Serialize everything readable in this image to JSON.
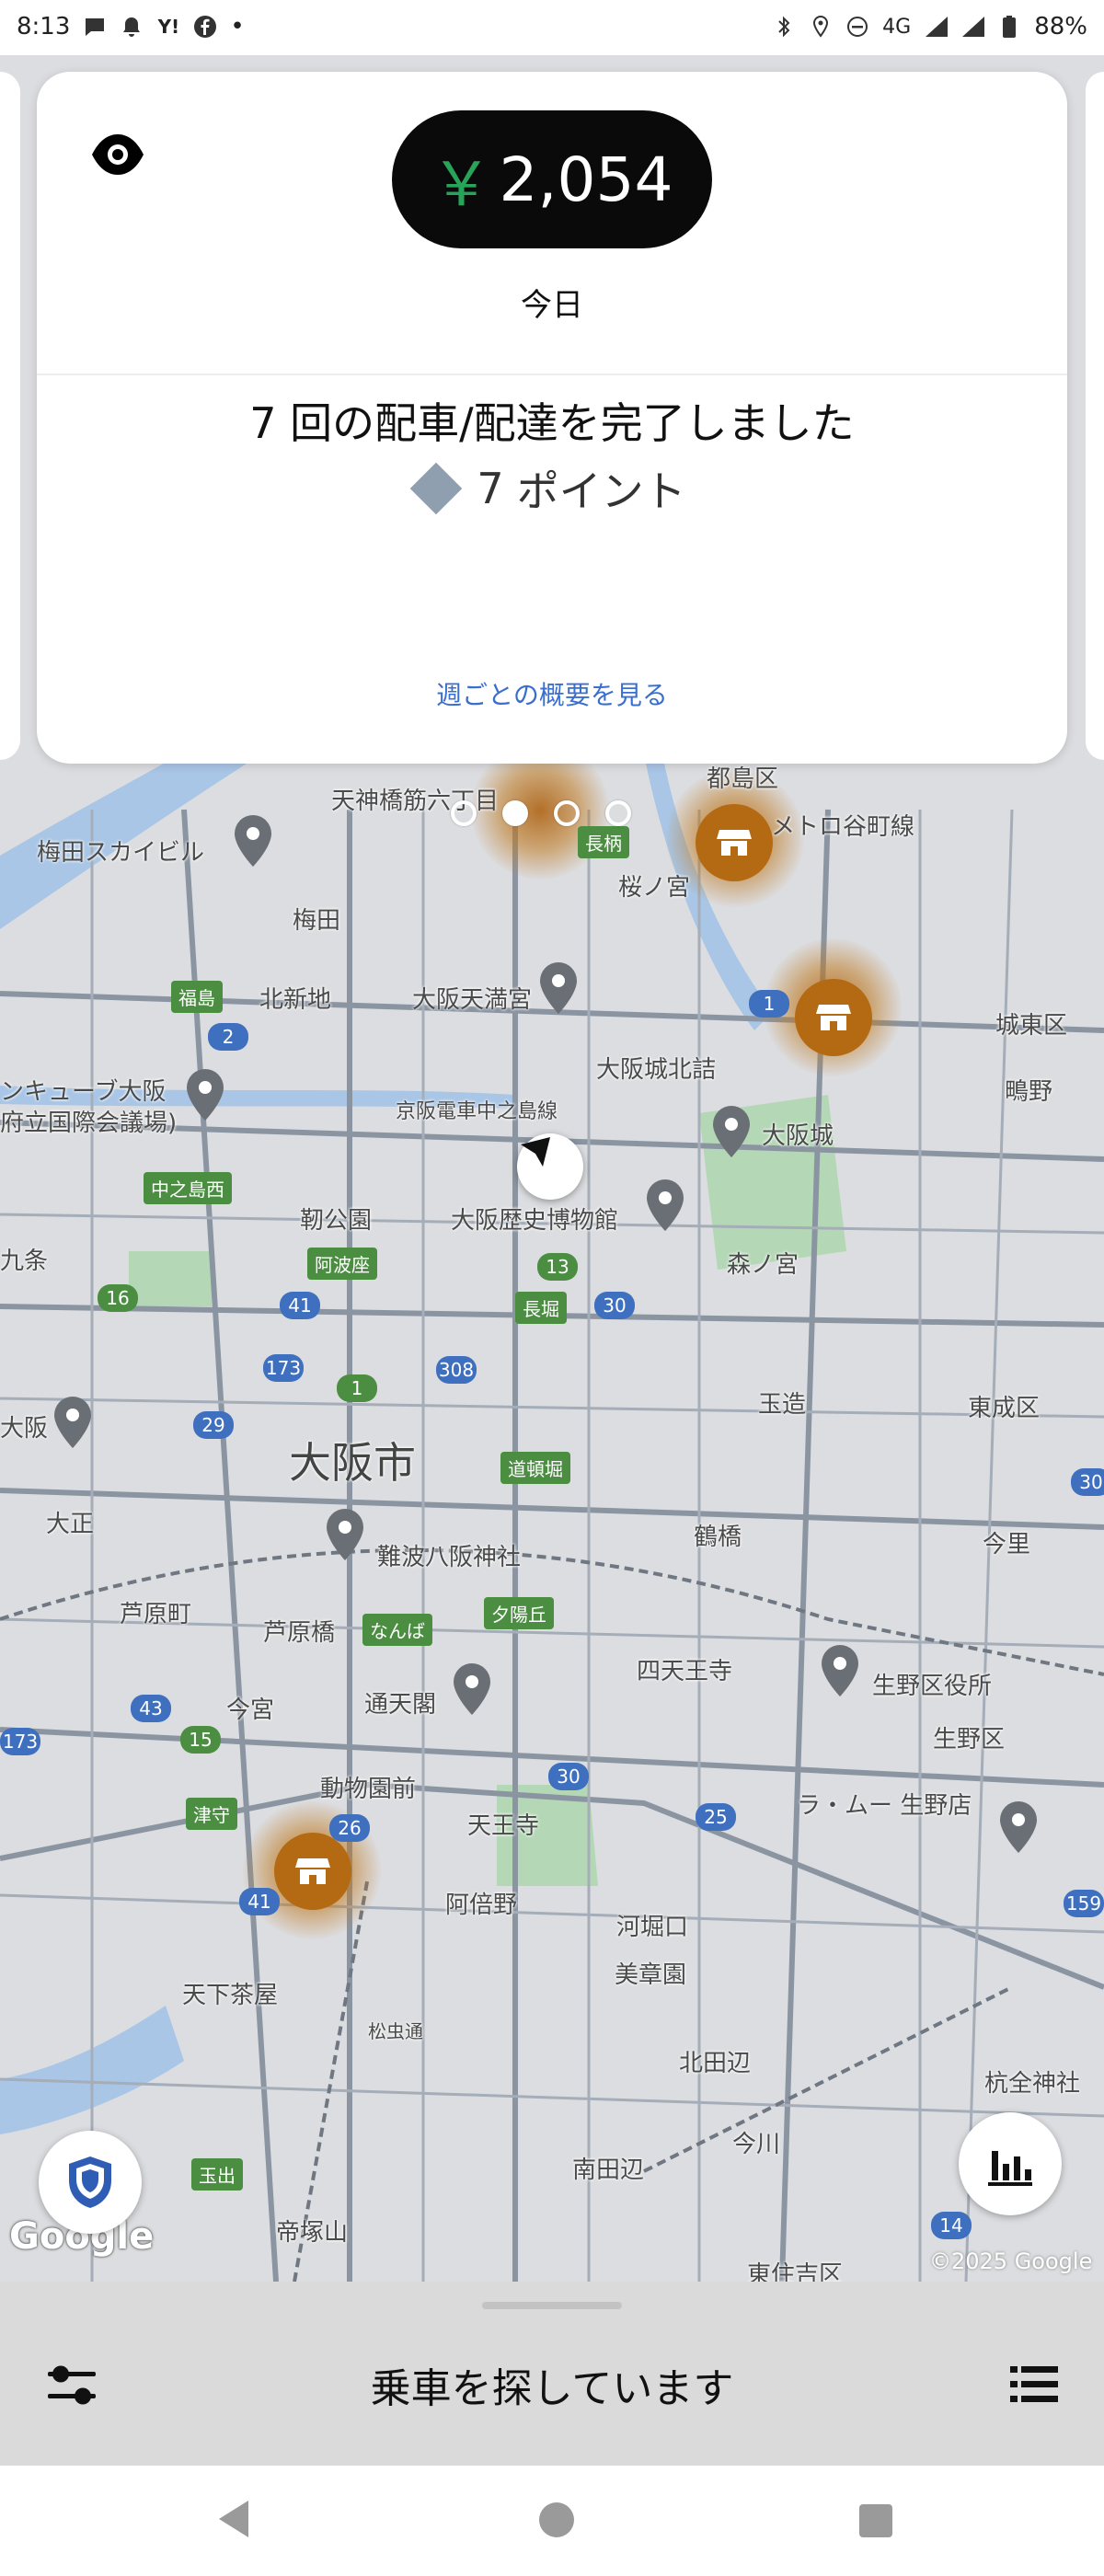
{
  "status_bar": {
    "time": "8:13",
    "notification_icons": [
      "chat-icon",
      "bell-icon",
      "yahoo-icon",
      "facebook-icon"
    ],
    "dot": "•",
    "status_icons": [
      "bluetooth-icon",
      "location-icon",
      "dnd-icon"
    ],
    "network": "4G",
    "battery": "88%"
  },
  "earnings_card": {
    "currency": "￥",
    "amount": "2,054",
    "period": "今日",
    "trips_text": "7 回の配車/配達を完了しました",
    "points_count": "7",
    "points_label": "ポイント",
    "weekly_link": "週ごとの概要を見る"
  },
  "pager": {
    "pages": 4,
    "active_index": 1
  },
  "map": {
    "labels": {
      "city": "大阪市",
      "umeda_sky": "梅田スカイビル",
      "tenjinbashi": "天神橋筋六丁目",
      "miyakojima": "都島区",
      "metro_miyakojima": "メトロ谷町線",
      "nagara": "長柄",
      "sakuranomiya": "桜ノ宮",
      "umeda": "梅田",
      "kitashinchi": "北新地",
      "osaka_tenmangu": "大阪天満宮",
      "fukushima": "福島",
      "joto": "城東区",
      "osakajo_kitazume": "大阪城北詰",
      "shigino": "鴫野",
      "keihan": "京阪電車中之島線",
      "cube_osaka": "ンキューブ大阪",
      "intl_conf": "府立国際会議場)",
      "osakajo": "大阪城",
      "nakanoshima_west": "中之島西",
      "utsubo": "靭公園",
      "history_museum": "大阪歴史博物館",
      "kujo": "九条",
      "awaza": "阿波座",
      "morinomiya": "森ノ宮",
      "nagahori": "長堀",
      "tamatsukuri": "玉造",
      "higashinari": "東成区",
      "osaka_dome": "大阪",
      "dotonbori": "道頓堀",
      "taisho": "大正",
      "tsuruhashi": "鶴橋",
      "imazato": "今里",
      "namba_yasaka": "難波八阪神社",
      "ashiharacho": "芦原町",
      "ashiharabashi": "芦原橋",
      "namba": "なんば",
      "yuhigaoka": "夕陽丘",
      "shitennoji": "四天王寺",
      "ikuno_ward_office": "生野区役所",
      "imamiya": "今宮",
      "tsutenkaku": "通天閣",
      "ikuno": "生野区",
      "dobutsuen": "動物園前",
      "tennoji": "天王寺",
      "ra_mu": "ラ・ムー 生野店",
      "tsumori": "津守",
      "abeno": "阿倍野",
      "kawahorikuchi": "河堀口",
      "tengachaya": "天下茶屋",
      "bishoen": "美章園",
      "matsubara": "松虫通",
      "kitatanabe": "北田辺",
      "kitatanabe2": "杭全神社",
      "imagawa": "今川",
      "minamitanabe": "南田辺",
      "tamade": "玉出",
      "teizukayama": "帝塚山",
      "higashisumiyoshi": "東住吉区"
    },
    "google_logo": "Google",
    "copyright": "©2025 Google"
  },
  "bottom_sheet": {
    "status": "乗車を探しています"
  },
  "colors": {
    "accent_green": "#27a35a",
    "link_blue": "#3a6fd0",
    "store_brown": "#b46a12",
    "card_bg": "#ffffff"
  }
}
